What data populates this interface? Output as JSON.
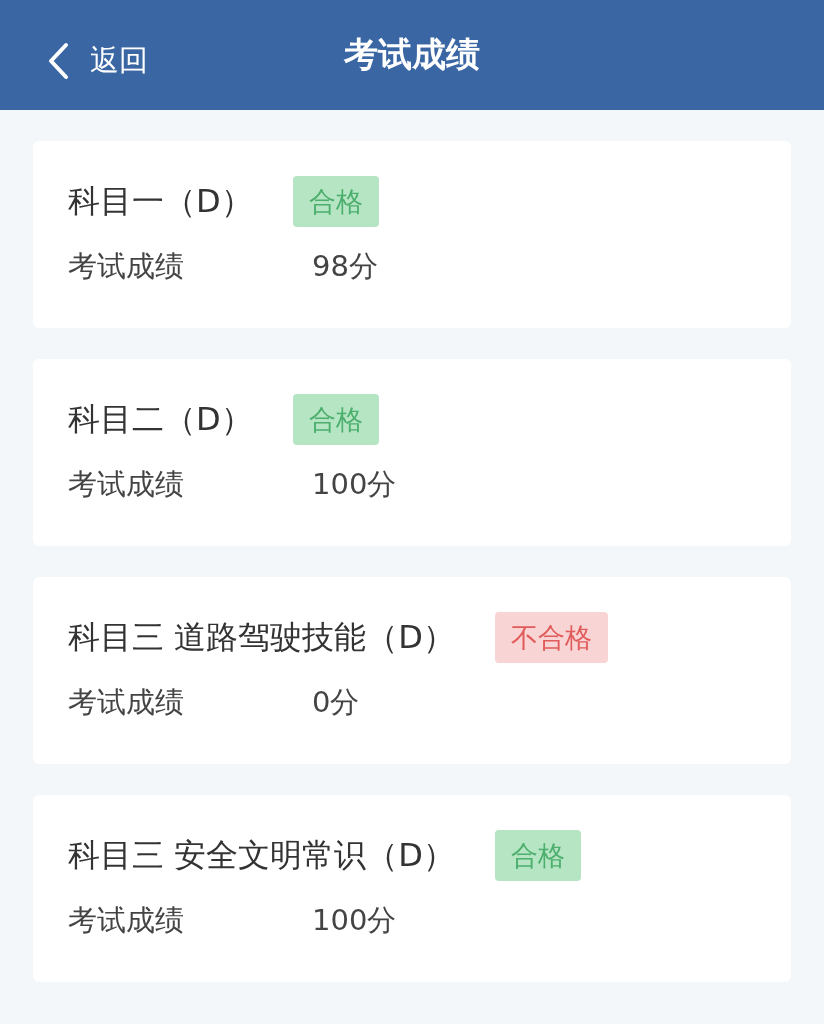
{
  "header": {
    "back_label": "返回",
    "title": "考试成绩"
  },
  "results": [
    {
      "subject": "科目一（D）",
      "badge": "合格",
      "passed": true,
      "score_label": "考试成绩",
      "score": "98分"
    },
    {
      "subject": "科目二（D）",
      "badge": "合格",
      "passed": true,
      "score_label": "考试成绩",
      "score": "100分"
    },
    {
      "subject": "科目三 道路驾驶技能（D）",
      "badge": "不合格",
      "passed": false,
      "score_label": "考试成绩",
      "score": "0分"
    },
    {
      "subject": "科目三 安全文明常识（D）",
      "badge": "合格",
      "passed": true,
      "score_label": "考试成绩",
      "score": "100分"
    }
  ]
}
